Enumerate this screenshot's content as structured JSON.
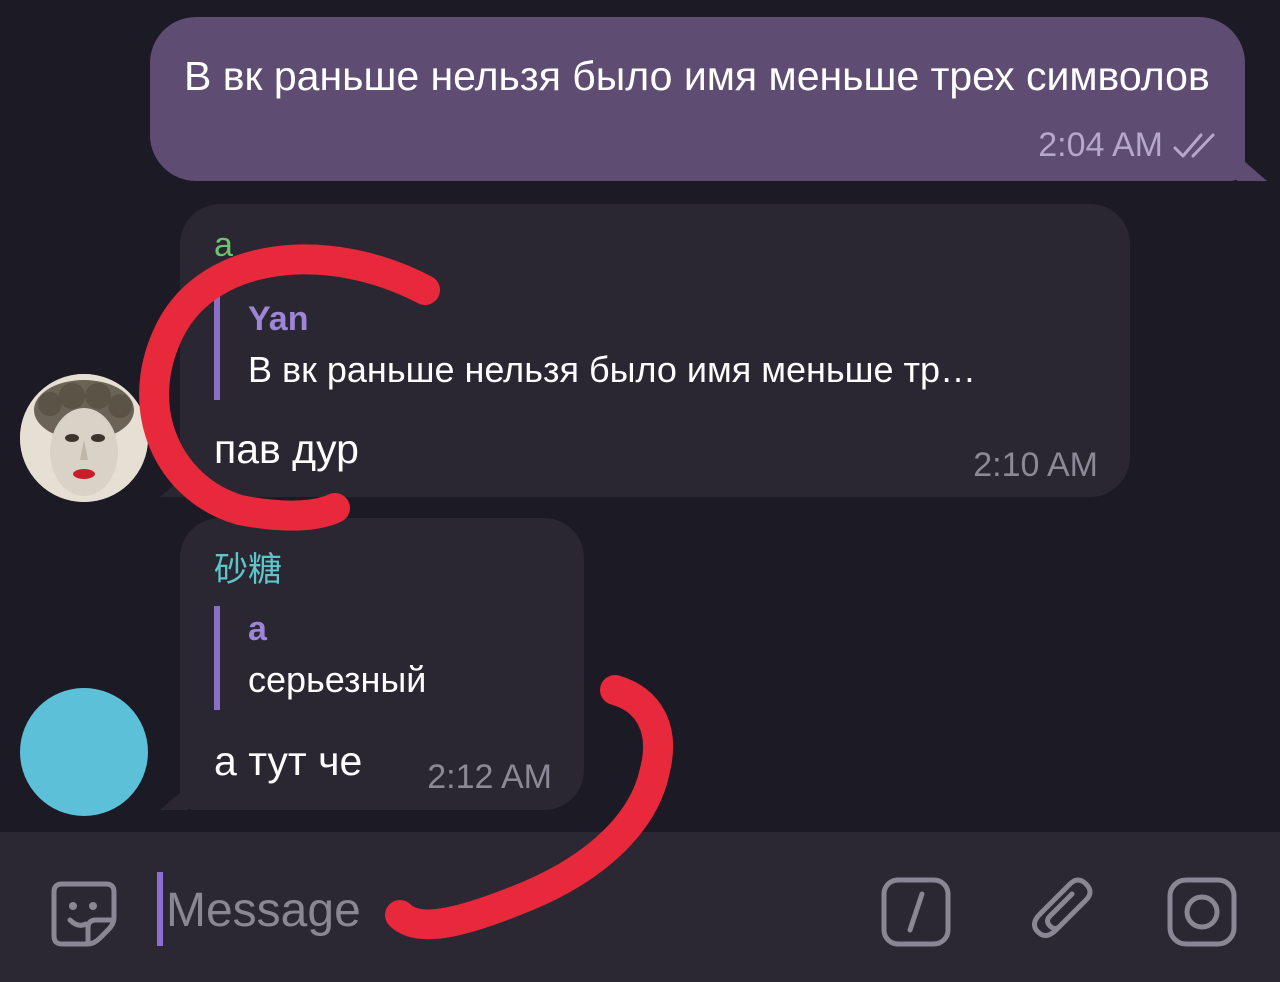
{
  "messages": [
    {
      "id": "out1",
      "direction": "outgoing",
      "text": "В вк раньше нельзя было имя меньше трех символов",
      "time": "2:04 AM",
      "status_icon": "double-check-icon"
    },
    {
      "id": "in1",
      "direction": "incoming",
      "sender": "а",
      "avatar_icon": "statue-face-avatar",
      "reply": {
        "name": "Yan",
        "text": "В вк раньше нельзя было имя меньше тр…"
      },
      "text": "пав дур",
      "time": "2:10 AM"
    },
    {
      "id": "in2",
      "direction": "incoming",
      "sender": "砂糖",
      "avatar_color": "#5cc0d8",
      "reply": {
        "name": "a",
        "text": "серьезный"
      },
      "text": "а тут че",
      "time": "2:12 AM"
    }
  ],
  "input": {
    "placeholder": "Message",
    "left_icon": "sticker-icon",
    "right_icons": [
      "bot-command-icon",
      "attach-icon",
      "camera-icon"
    ]
  },
  "colors": {
    "background": "#1c1a25",
    "outgoing_bubble": "#5e4c72",
    "incoming_bubble": "#2a2733",
    "accent": "#8b70d2",
    "annotation": "#e8283b"
  },
  "annotations": [
    "red-circle-marker",
    "red-swoosh-marker"
  ]
}
